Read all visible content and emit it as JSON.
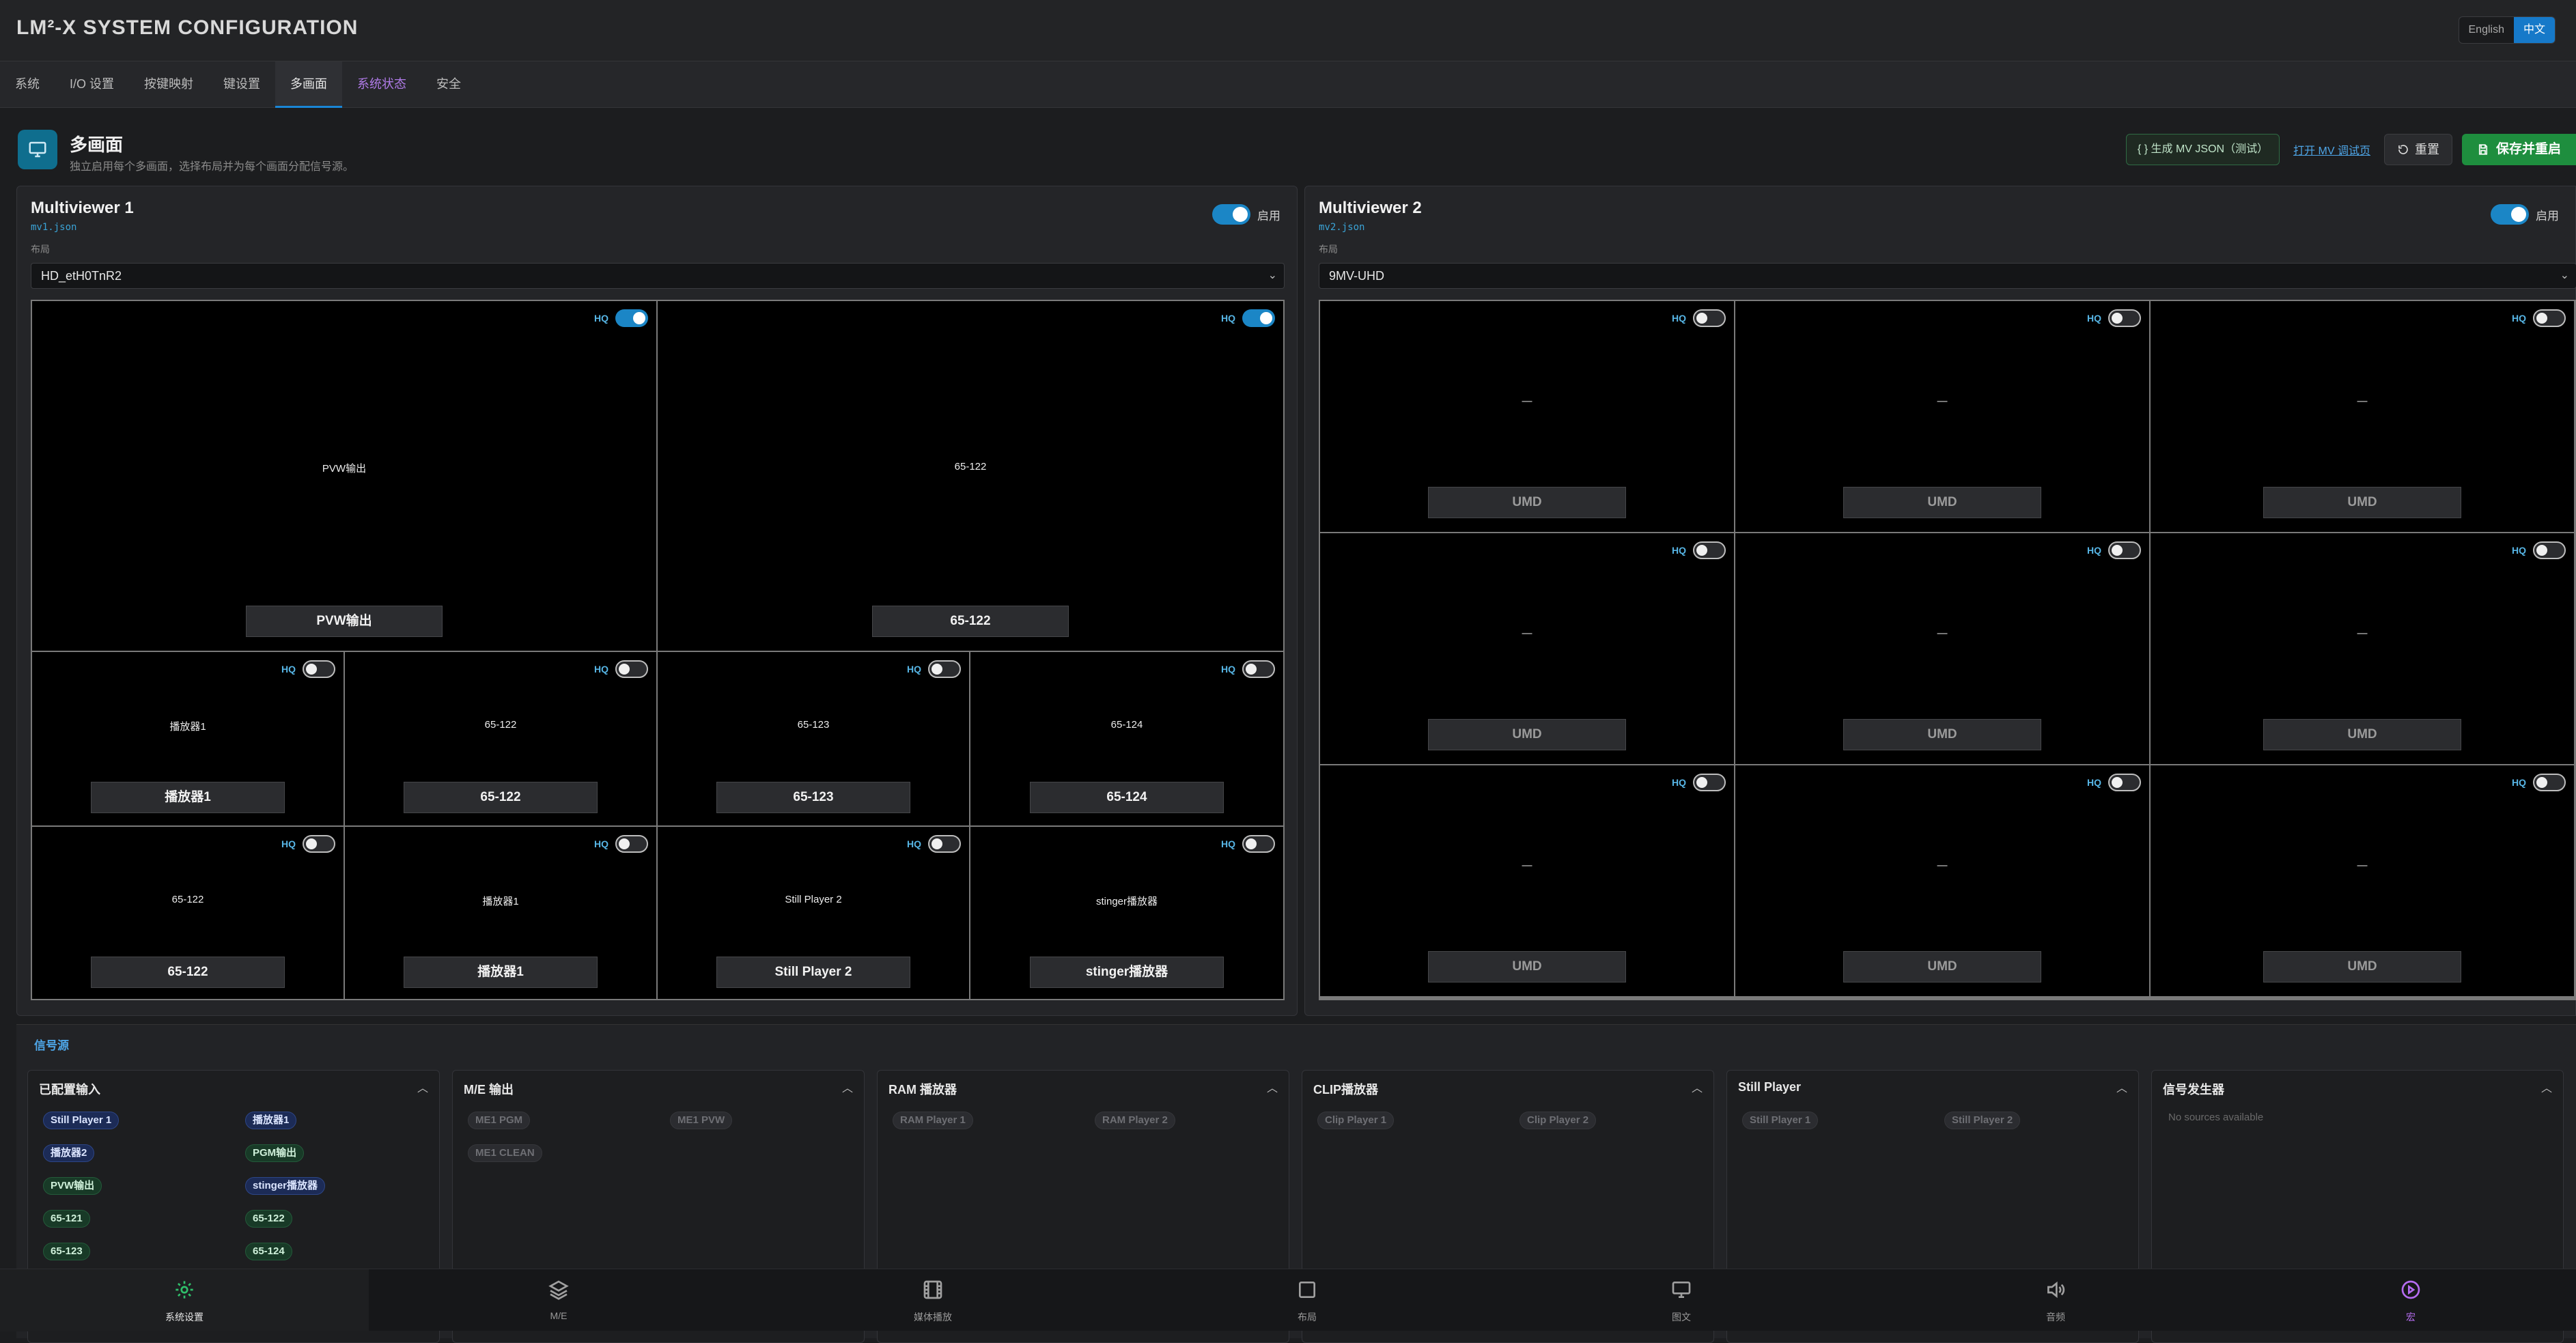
{
  "app": {
    "title": "LM²-X SYSTEM CONFIGURATION"
  },
  "lang": {
    "en": "English",
    "zh": "中文"
  },
  "tabs": [
    {
      "label": "系统"
    },
    {
      "label": "I/O 设置"
    },
    {
      "label": "按键映射"
    },
    {
      "label": "键设置"
    },
    {
      "label": "多画面"
    },
    {
      "label": "系统状态"
    },
    {
      "label": "安全"
    }
  ],
  "section": {
    "title": "多画面",
    "subtitle": "独立启用每个多画面，选择布局并为每个画面分配信号源。"
  },
  "actions": {
    "json": "{ } 生成 MV JSON（测试）",
    "debug": "打开 MV 调试页",
    "reset": "重置",
    "save": "保存并重启"
  },
  "mv1": {
    "name": "Multiviewer 1",
    "file": "mv1.json",
    "enable": "启用",
    "layout_label": "布局",
    "layout": "HD_etH0TnR2",
    "cells": [
      {
        "src": "PVW输出",
        "umd": "PVW输出",
        "hq": "HQ"
      },
      {
        "src": "65-122",
        "umd": "65-122",
        "hq": "HQ"
      },
      {
        "src": "播放器1",
        "umd": "播放器1",
        "hq": "HQ"
      },
      {
        "src": "65-122",
        "umd": "65-122",
        "hq": "HQ"
      },
      {
        "src": "65-123",
        "umd": "65-123",
        "hq": "HQ"
      },
      {
        "src": "65-124",
        "umd": "65-124",
        "hq": "HQ"
      },
      {
        "src": "65-122",
        "umd": "65-122",
        "hq": "HQ"
      },
      {
        "src": "播放器1",
        "umd": "播放器1",
        "hq": "HQ"
      },
      {
        "src": "Still Player 2",
        "umd": "Still Player 2",
        "hq": "HQ"
      },
      {
        "src": "stinger播放器",
        "umd": "stinger播放器",
        "hq": "HQ"
      }
    ]
  },
  "mv2": {
    "name": "Multiviewer 2",
    "file": "mv2.json",
    "enable": "启用",
    "layout_label": "布局",
    "layout": "9MV-UHD",
    "cell_src": "—",
    "cell_umd": "UMD",
    "hq": "HQ"
  },
  "signals": {
    "title": "信号源",
    "configured": {
      "title": "已配置输入",
      "chips": [
        "Still Player 1",
        "播放器1",
        "播放器2",
        "PGM输出",
        "PVW输出",
        "stinger播放器",
        "65-121",
        "65-122",
        "65-123",
        "65-124"
      ]
    },
    "me": {
      "title": "M/E 输出",
      "chips": [
        "ME1 PGM",
        "ME1 PVW",
        "ME1 CLEAN"
      ]
    },
    "ram": {
      "title": "RAM 播放器",
      "chips": [
        "RAM Player 1",
        "RAM Player 2"
      ]
    },
    "clip": {
      "title": "CLIP播放器",
      "chips": [
        "Clip Player 1",
        "Clip Player 2"
      ]
    },
    "still": {
      "title": "Still Player",
      "chips": [
        "Still Player 1",
        "Still Player 2"
      ]
    },
    "gen": {
      "title": "信号发生器",
      "empty": "No sources available"
    }
  },
  "nav": {
    "logo": "N",
    "items": [
      {
        "label": "系统设置"
      },
      {
        "label": "M/E"
      },
      {
        "label": "媒体播放"
      },
      {
        "label": "布局"
      },
      {
        "label": "图文"
      },
      {
        "label": "音频"
      },
      {
        "label": "宏"
      }
    ]
  },
  "colors": {
    "accent": "#1b86c6",
    "save": "#1e8e3e",
    "active_nav": "#2fbf6a"
  }
}
